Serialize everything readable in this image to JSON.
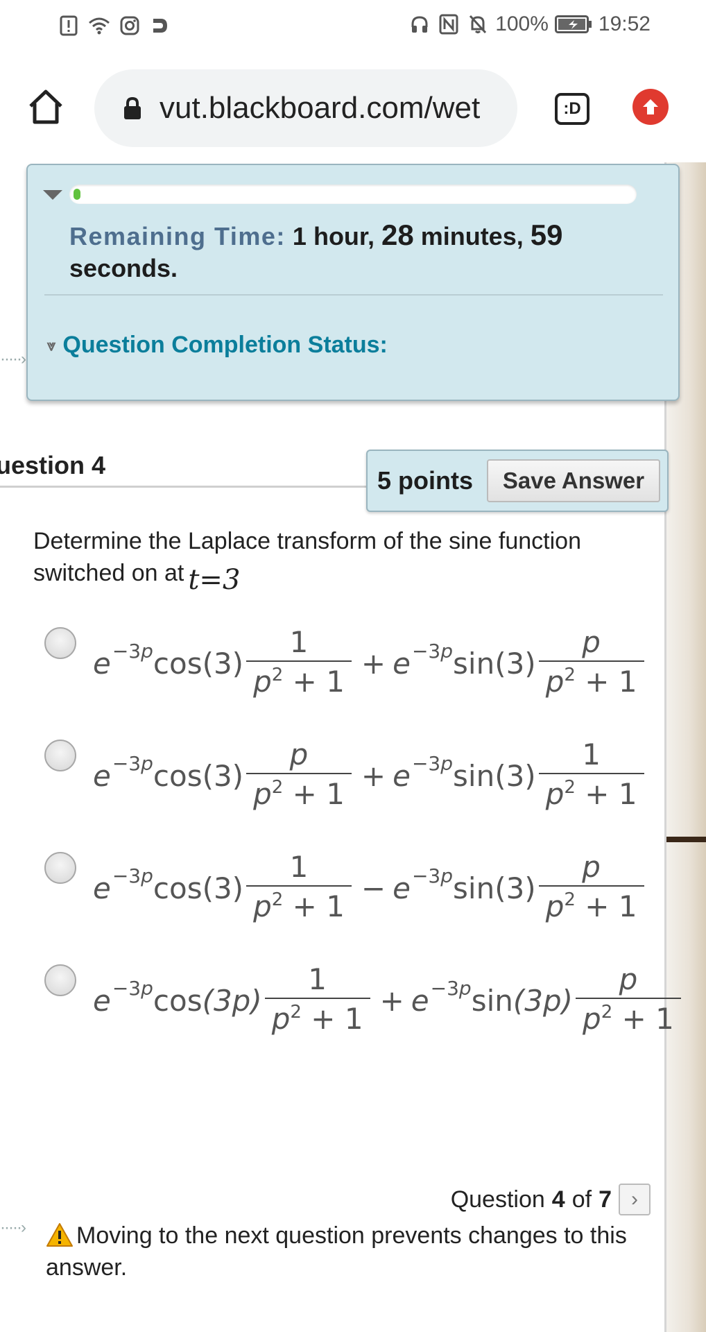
{
  "status_bar": {
    "battery": "100%",
    "time": "19:52",
    "left_icons": [
      "alert-icon",
      "wifi-icon",
      "instagram-icon",
      "app-icon"
    ],
    "right_icons": [
      "headphones-icon",
      "nfc-icon",
      "mute-icon",
      "battery-icon"
    ]
  },
  "browser": {
    "url": "vut.blackboard.com/wet",
    "tab_label": ":D"
  },
  "timer": {
    "label": "Remaining Time:",
    "hour_value": "1",
    "hour_unit": "hour,",
    "minutes_value": "28",
    "minutes_unit": "minutes,",
    "seconds_value": "59",
    "seconds_unit": "seconds.",
    "progress_fraction": 0.01,
    "completion_status_label": "Question Completion Status:"
  },
  "question": {
    "title": "uestion 4",
    "points": "5 points",
    "save_label": "Save Answer",
    "prompt": "Determine the Laplace transform of the sine function switched on at",
    "variable": "t=3",
    "options": [
      {
        "cos_arg": "(3)",
        "frac1_num": "1",
        "operator": "+",
        "sin_arg": "(3)",
        "frac2_num": "p"
      },
      {
        "cos_arg": "(3)",
        "frac1_num": "p",
        "operator": "+",
        "sin_arg": "(3)",
        "frac2_num": "1"
      },
      {
        "cos_arg": "(3)",
        "frac1_num": "1",
        "operator": "−",
        "sin_arg": "(3)",
        "frac2_num": "p"
      },
      {
        "cos_arg": "(3p)",
        "frac1_num": "1",
        "operator": "+",
        "sin_arg": "(3p)",
        "frac2_num": "p"
      }
    ]
  },
  "navigation": {
    "prefix": "Question",
    "current": "4",
    "of": "of",
    "total": "7",
    "warning": "Moving to the next question prevents changes to this answer."
  }
}
